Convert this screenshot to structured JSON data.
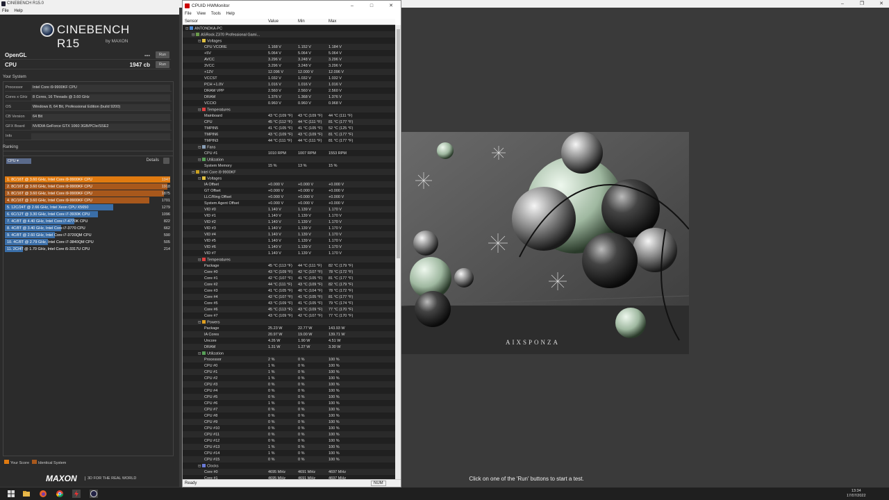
{
  "cinebench": {
    "window_title": "CINEBENCH R15.0",
    "menu": [
      "File",
      "Help"
    ],
    "logo_name": "CINEBENCH R15",
    "logo_sub": "by MAXON",
    "opengl": {
      "label": "OpenGL",
      "value": "---",
      "run": "Run"
    },
    "cpu": {
      "label": "CPU",
      "value": "1947 cb",
      "run": "Run"
    },
    "your_system_title": "Your System",
    "system": [
      {
        "k": "Processor",
        "v": "Intel Core i9-9900KF CPU"
      },
      {
        "k": "Cores x GHz",
        "v": "8 Cores, 16 Threads @ 3.60 GHz"
      },
      {
        "k": "OS",
        "v": "Windows 8, 64 Bit, Professional Edition (build 9200)"
      },
      {
        "k": "CB Version",
        "v": "64 Bit"
      },
      {
        "k": "GFX Board",
        "v": "NVIDIA GeForce GTX 1060 3GB/PCIe/SSE2"
      },
      {
        "k": "Info",
        "v": ""
      }
    ],
    "ranking_title": "Ranking",
    "ranking_select": "CPU",
    "ranking_details": "Details",
    "ranking": [
      {
        "label": "1. 8C/16T @ 3.60 GHz, Intel Core i9-9900KF CPU",
        "score": "1947",
        "value": 1947,
        "color": "#e07a10"
      },
      {
        "label": "2. 8C/16T @ 3.60 GHz, Intel Core i9-9900KF CPU",
        "score": "1918",
        "value": 1918,
        "color": "#a8581c"
      },
      {
        "label": "3. 8C/16T @ 3.60 GHz, Intel Core i9-9900KF CPU",
        "score": "1875",
        "value": 1875,
        "color": "#a8581c"
      },
      {
        "label": "4. 8C/16T @ 3.60 GHz, Intel Core i9-9900KF CPU",
        "score": "1701",
        "value": 1701,
        "color": "#a8581c"
      },
      {
        "label": "5. 12C/24T @ 2.66 GHz, Intel Xeon CPU X5650",
        "score": "1279",
        "value": 1279,
        "color": "#3a6ea8"
      },
      {
        "label": "6. 6C/12T @ 3.30 GHz,  Intel Core i7-3930K CPU",
        "score": "1096",
        "value": 1096,
        "color": "#3a6ea8"
      },
      {
        "label": "7. 4C/8T @ 4.40 GHz, Intel Core i7-4770K CPU",
        "score": "822",
        "value": 822,
        "color": "#3a6ea8"
      },
      {
        "label": "8. 4C/8T @ 3.40 GHz,  Intel Core i7-3770 CPU",
        "score": "662",
        "value": 662,
        "color": "#3a6ea8"
      },
      {
        "label": "9. 4C/8T @ 2.60 GHz, Intel Core i7-3720QM CPU",
        "score": "590",
        "value": 590,
        "color": "#3a6ea8"
      },
      {
        "label": "10. 4C/8T @ 2.79 GHz,  Intel Core i7-3840QM CPU",
        "score": "505",
        "value": 505,
        "color": "#3a6ea8"
      },
      {
        "label": "11. 2C/4T @ 1.70 GHz,  Intel Core i5-3317U CPU",
        "score": "214",
        "value": 214,
        "color": "#3a6ea8"
      }
    ],
    "legend_your_score": "Your Score",
    "legend_identical": "Identical System",
    "maxon": "MAXON",
    "maxon_tag": "3D FOR THE REAL WORLD",
    "render_hint": "Click on one of the 'Run' buttons to start a test.",
    "render_watermark": "AIXSPONZA"
  },
  "hwmonitor": {
    "window_title": "CPUID HWMonitor",
    "menu": [
      "File",
      "View",
      "Tools",
      "Help"
    ],
    "columns": [
      "Sensor",
      "Value",
      "Min",
      "Max"
    ],
    "status": "Ready",
    "num": "NUM",
    "rows": [
      {
        "d": 0,
        "t": "node",
        "icon": "pc",
        "n": "ANTONDKA-PC"
      },
      {
        "d": 1,
        "t": "node",
        "icon": "board",
        "n": "ASRock Z370 Professional Gami..."
      },
      {
        "d": 2,
        "t": "group",
        "icon": "volt",
        "n": "Voltages"
      },
      {
        "d": 3,
        "n": "CPU VCORE",
        "v": "1.168 V",
        "mn": "1.152 V",
        "mx": "1.184 V"
      },
      {
        "d": 3,
        "n": "+5V",
        "v": "5.064 V",
        "mn": "5.064 V",
        "mx": "5.064 V"
      },
      {
        "d": 3,
        "n": "AVCC",
        "v": "3.296 V",
        "mn": "3.248 V",
        "mx": "3.296 V"
      },
      {
        "d": 3,
        "n": "3VCC",
        "v": "3.296 V",
        "mn": "3.248 V",
        "mx": "3.296 V"
      },
      {
        "d": 3,
        "n": "+12V",
        "v": "12.096 V",
        "mn": "12.000 V",
        "mx": "12.096 V"
      },
      {
        "d": 3,
        "n": "VCCST",
        "v": "1.032 V",
        "mn": "1.032 V",
        "mx": "1.032 V"
      },
      {
        "d": 3,
        "n": "PCH +1.0V",
        "v": "1.016 V",
        "mn": "1.016 V",
        "mx": "1.016 V"
      },
      {
        "d": 3,
        "n": "DRAM VPP",
        "v": "2.560 V",
        "mn": "2.560 V",
        "mx": "2.560 V"
      },
      {
        "d": 3,
        "n": "DRAM",
        "v": "1.376 V",
        "mn": "1.368 V",
        "mx": "1.376 V"
      },
      {
        "d": 3,
        "n": "VCCIO",
        "v": "0.960 V",
        "mn": "0.960 V",
        "mx": "0.968 V"
      },
      {
        "d": 2,
        "t": "group",
        "icon": "temp",
        "n": "Temperatures"
      },
      {
        "d": 3,
        "n": "Mainboard",
        "v": "43 °C  (109 °F)",
        "mn": "43 °C  (109 °F)",
        "mx": "44 °C  (111 °F)"
      },
      {
        "d": 3,
        "n": "CPU",
        "v": "45 °C  (112 °F)",
        "mn": "44 °C  (111 °F)",
        "mx": "81 °C  (177 °F)"
      },
      {
        "d": 3,
        "n": "TMPIN5",
        "v": "41 °C  (105 °F)",
        "mn": "41 °C  (105 °F)",
        "mx": "52 °C  (125 °F)"
      },
      {
        "d": 3,
        "n": "TMPIN6",
        "v": "43 °C  (109 °F)",
        "mn": "43 °C  (109 °F)",
        "mx": "81 °C  (177 °F)"
      },
      {
        "d": 3,
        "n": "TMPIN3",
        "v": "44 °C  (111 °F)",
        "mn": "44 °C  (111 °F)",
        "mx": "81 °C  (177 °F)"
      },
      {
        "d": 2,
        "t": "group",
        "icon": "fan",
        "n": "Fans"
      },
      {
        "d": 3,
        "n": "CPU #1",
        "v": "1010 RPM",
        "mn": "1007 RPM",
        "mx": "1553 RPM"
      },
      {
        "d": 2,
        "t": "group",
        "icon": "util",
        "n": "Utilization"
      },
      {
        "d": 3,
        "n": "System Memory",
        "v": "15 %",
        "mn": "13 %",
        "mx": "15 %"
      },
      {
        "d": 1,
        "t": "node",
        "icon": "chip",
        "n": "Intel Core i9 9900KF"
      },
      {
        "d": 2,
        "t": "group",
        "icon": "volt",
        "n": "Voltages"
      },
      {
        "d": 3,
        "n": "IA Offset",
        "v": "+0.000 V",
        "mn": "+0.000 V",
        "mx": "+0.000 V"
      },
      {
        "d": 3,
        "n": "GT Offset",
        "v": "+0.000 V",
        "mn": "+0.000 V",
        "mx": "+0.000 V"
      },
      {
        "d": 3,
        "n": "LLC/Ring Offset",
        "v": "+0.000 V",
        "mn": "+0.000 V",
        "mx": "+0.000 V"
      },
      {
        "d": 3,
        "n": "System Agent Offset",
        "v": "+0.000 V",
        "mn": "+0.000 V",
        "mx": "+0.000 V"
      },
      {
        "d": 3,
        "n": "VID #0",
        "v": "1.140 V",
        "mn": "1.139 V",
        "mx": "1.170 V"
      },
      {
        "d": 3,
        "n": "VID #1",
        "v": "1.140 V",
        "mn": "1.139 V",
        "mx": "1.170 V"
      },
      {
        "d": 3,
        "n": "VID #2",
        "v": "1.140 V",
        "mn": "1.139 V",
        "mx": "1.170 V"
      },
      {
        "d": 3,
        "n": "VID #3",
        "v": "1.140 V",
        "mn": "1.139 V",
        "mx": "1.170 V"
      },
      {
        "d": 3,
        "n": "VID #4",
        "v": "1.140 V",
        "mn": "1.139 V",
        "mx": "1.170 V"
      },
      {
        "d": 3,
        "n": "VID #5",
        "v": "1.140 V",
        "mn": "1.139 V",
        "mx": "1.170 V"
      },
      {
        "d": 3,
        "n": "VID #6",
        "v": "1.140 V",
        "mn": "1.139 V",
        "mx": "1.170 V"
      },
      {
        "d": 3,
        "n": "VID #7",
        "v": "1.140 V",
        "mn": "1.139 V",
        "mx": "1.170 V"
      },
      {
        "d": 2,
        "t": "group",
        "icon": "temp",
        "n": "Temperatures"
      },
      {
        "d": 3,
        "n": "Package",
        "v": "45 °C  (113 °F)",
        "mn": "44 °C  (111 °F)",
        "mx": "82 °C  (179 °F)"
      },
      {
        "d": 3,
        "n": "Core #0",
        "v": "43 °C  (109 °F)",
        "mn": "42 °C  (107 °F)",
        "mx": "78 °C  (172 °F)"
      },
      {
        "d": 3,
        "n": "Core #1",
        "v": "42 °C  (107 °F)",
        "mn": "41 °C  (105 °F)",
        "mx": "81 °C  (177 °F)"
      },
      {
        "d": 3,
        "n": "Core #2",
        "v": "44 °C  (111 °F)",
        "mn": "43 °C  (109 °F)",
        "mx": "82 °C  (179 °F)"
      },
      {
        "d": 3,
        "n": "Core #3",
        "v": "41 °C  (105 °F)",
        "mn": "40 °C  (104 °F)",
        "mx": "78 °C  (172 °F)"
      },
      {
        "d": 3,
        "n": "Core #4",
        "v": "42 °C  (107 °F)",
        "mn": "41 °C  (105 °F)",
        "mx": "81 °C  (177 °F)"
      },
      {
        "d": 3,
        "n": "Core #5",
        "v": "43 °C  (109 °F)",
        "mn": "41 °C  (105 °F)",
        "mx": "79 °C  (174 °F)"
      },
      {
        "d": 3,
        "n": "Core #6",
        "v": "45 °C  (113 °F)",
        "mn": "43 °C  (109 °F)",
        "mx": "77 °C  (170 °F)"
      },
      {
        "d": 3,
        "n": "Core #7",
        "v": "43 °C  (109 °F)",
        "mn": "42 °C  (107 °F)",
        "mx": "77 °C  (170 °F)"
      },
      {
        "d": 2,
        "t": "group",
        "icon": "power",
        "n": "Powers"
      },
      {
        "d": 3,
        "n": "Package",
        "v": "25.23 W",
        "mn": "22.77 W",
        "mx": "143.93 W"
      },
      {
        "d": 3,
        "n": "IA Cores",
        "v": "20.97 W",
        "mn": "19.00 W",
        "mx": "139.71 W"
      },
      {
        "d": 3,
        "n": "Uncore",
        "v": "4.26 W",
        "mn": "1.90 W",
        "mx": "4.51 W"
      },
      {
        "d": 3,
        "n": "DRAM",
        "v": "1.31 W",
        "mn": "1.27 W",
        "mx": "3.30 W"
      },
      {
        "d": 2,
        "t": "group",
        "icon": "util",
        "n": "Utilization"
      },
      {
        "d": 3,
        "n": "Processor",
        "v": "2 %",
        "mn": "0 %",
        "mx": "100 %"
      },
      {
        "d": 3,
        "n": "CPU #0",
        "v": "1 %",
        "mn": "0 %",
        "mx": "100 %"
      },
      {
        "d": 3,
        "n": "CPU #1",
        "v": "1 %",
        "mn": "0 %",
        "mx": "100 %"
      },
      {
        "d": 3,
        "n": "CPU #2",
        "v": "1 %",
        "mn": "0 %",
        "mx": "100 %"
      },
      {
        "d": 3,
        "n": "CPU #3",
        "v": "0 %",
        "mn": "0 %",
        "mx": "100 %"
      },
      {
        "d": 3,
        "n": "CPU #4",
        "v": "0 %",
        "mn": "0 %",
        "mx": "100 %"
      },
      {
        "d": 3,
        "n": "CPU #5",
        "v": "0 %",
        "mn": "0 %",
        "mx": "100 %"
      },
      {
        "d": 3,
        "n": "CPU #6",
        "v": "1 %",
        "mn": "0 %",
        "mx": "100 %"
      },
      {
        "d": 3,
        "n": "CPU #7",
        "v": "0 %",
        "mn": "0 %",
        "mx": "100 %"
      },
      {
        "d": 3,
        "n": "CPU #8",
        "v": "0 %",
        "mn": "0 %",
        "mx": "100 %"
      },
      {
        "d": 3,
        "n": "CPU #9",
        "v": "0 %",
        "mn": "0 %",
        "mx": "100 %"
      },
      {
        "d": 3,
        "n": "CPU #10",
        "v": "0 %",
        "mn": "0 %",
        "mx": "100 %"
      },
      {
        "d": 3,
        "n": "CPU #11",
        "v": "0 %",
        "mn": "0 %",
        "mx": "100 %"
      },
      {
        "d": 3,
        "n": "CPU #12",
        "v": "0 %",
        "mn": "0 %",
        "mx": "100 %"
      },
      {
        "d": 3,
        "n": "CPU #13",
        "v": "1 %",
        "mn": "0 %",
        "mx": "100 %"
      },
      {
        "d": 3,
        "n": "CPU #14",
        "v": "1 %",
        "mn": "0 %",
        "mx": "100 %"
      },
      {
        "d": 3,
        "n": "CPU #15",
        "v": "0 %",
        "mn": "0 %",
        "mx": "100 %"
      },
      {
        "d": 2,
        "t": "group",
        "icon": "clock",
        "n": "Clocks"
      },
      {
        "d": 3,
        "n": "Core #0",
        "v": "4695 MHz",
        "mn": "4691 MHz",
        "mx": "4697 MHz"
      },
      {
        "d": 3,
        "n": "Core #1",
        "v": "4695 MHz",
        "mn": "4691 MHz",
        "mx": "4697 MHz"
      }
    ]
  },
  "taskbar": {
    "apps": [
      "start-icon",
      "file-explorer-icon",
      "firefox-icon",
      "chrome-icon",
      "hwmonitor-icon",
      "cinebench-icon"
    ],
    "time": "13:34",
    "date": "17/07/2022"
  }
}
